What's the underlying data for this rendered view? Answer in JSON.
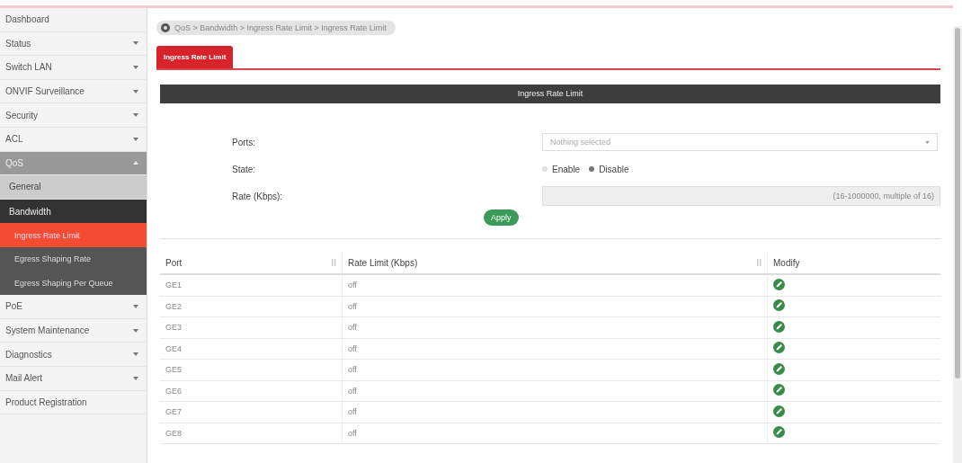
{
  "sidebar": {
    "items": [
      {
        "label": "Dashboard",
        "kind": "link",
        "selected": false
      },
      {
        "label": "Status",
        "kind": "group",
        "expanded": false
      },
      {
        "label": "Switch LAN",
        "kind": "group",
        "expanded": false
      },
      {
        "label": "ONVIF Surveillance",
        "kind": "group",
        "expanded": false
      },
      {
        "label": "Security",
        "kind": "group",
        "expanded": false
      },
      {
        "label": "ACL",
        "kind": "group",
        "expanded": false
      },
      {
        "label": "QoS",
        "kind": "group",
        "expanded": true,
        "children": [
          {
            "label": "General",
            "kind": "link",
            "selected": false
          },
          {
            "label": "Bandwidth",
            "kind": "group",
            "expanded": true,
            "children": [
              {
                "label": "Ingress Rate Limit",
                "kind": "link",
                "selected": true
              },
              {
                "label": "Egress Shaping Rate",
                "kind": "link",
                "selected": false
              },
              {
                "label": "Egress Shaping Per Queue",
                "kind": "link",
                "selected": false
              }
            ]
          }
        ]
      },
      {
        "label": "PoE",
        "kind": "group",
        "expanded": false
      },
      {
        "label": "System Maintenance",
        "kind": "group",
        "expanded": false
      },
      {
        "label": "Diagnostics",
        "kind": "group",
        "expanded": false
      },
      {
        "label": "Mail Alert",
        "kind": "group",
        "expanded": false
      },
      {
        "label": "Product Registration",
        "kind": "link",
        "selected": false
      }
    ]
  },
  "breadcrumb": "QoS > Bandwidth > Ingress Rate Limit > Ingress Rate Limit",
  "tabs": [
    {
      "label": "Ingress Rate Limit",
      "selected": true
    }
  ],
  "panel": {
    "title": "Ingress Rate Limit",
    "ports": {
      "label": "Ports:",
      "placeholder": "Nothing selected"
    },
    "state": {
      "label": "State:",
      "options": [
        {
          "label": "Enable",
          "selected": false
        },
        {
          "label": "Disable",
          "selected": true
        }
      ]
    },
    "rate": {
      "label": "Rate (Kbps):",
      "hint": "(16-1000000, multiple of 16)"
    },
    "apply": "Apply"
  },
  "table": {
    "columns": [
      "Port",
      "Rate Limit (Kbps)",
      "Modify"
    ],
    "rows": [
      {
        "port": "GE1",
        "rate": "off"
      },
      {
        "port": "GE2",
        "rate": "off"
      },
      {
        "port": "GE3",
        "rate": "off"
      },
      {
        "port": "GE4",
        "rate": "off"
      },
      {
        "port": "GE5",
        "rate": "off"
      },
      {
        "port": "GE6",
        "rate": "off"
      },
      {
        "port": "GE7",
        "rate": "off"
      },
      {
        "port": "GE8",
        "rate": "off"
      }
    ]
  }
}
